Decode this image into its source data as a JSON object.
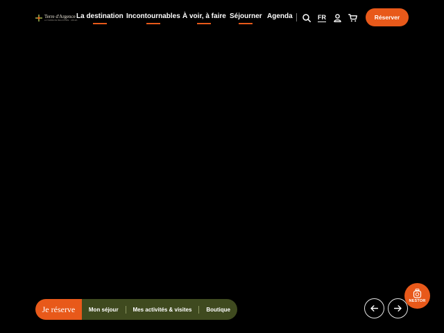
{
  "header": {
    "logo": {
      "name": "Terre d'Argence",
      "subtitle": "LA TERRE DE BEAUCAIRE · ARLES"
    },
    "nav": [
      {
        "label": "La destination",
        "underline": true
      },
      {
        "label": "Incontournables",
        "underline": true
      },
      {
        "label": "À voir, à faire",
        "underline": true
      },
      {
        "label": "Séjourner",
        "underline": true
      },
      {
        "label": "Agenda",
        "underline": false
      }
    ],
    "icons": [
      "search-icon",
      "user-icon",
      "cart-icon"
    ],
    "language": "FR",
    "cta_label": "Réserver"
  },
  "booking_bar": {
    "main_label": "Je réserve",
    "items": [
      "Mon séjour",
      "Mes activités & visites",
      "Boutique"
    ]
  },
  "carousel": {
    "prev_icon": "arrow-left-icon",
    "next_icon": "arrow-right-icon"
  },
  "chat_widget": {
    "label": "NESTOR",
    "icon": "nestor-bot-icon"
  },
  "colors": {
    "accent": "#e8591a",
    "bar_green": "#3f4a1f",
    "background": "#000000"
  }
}
